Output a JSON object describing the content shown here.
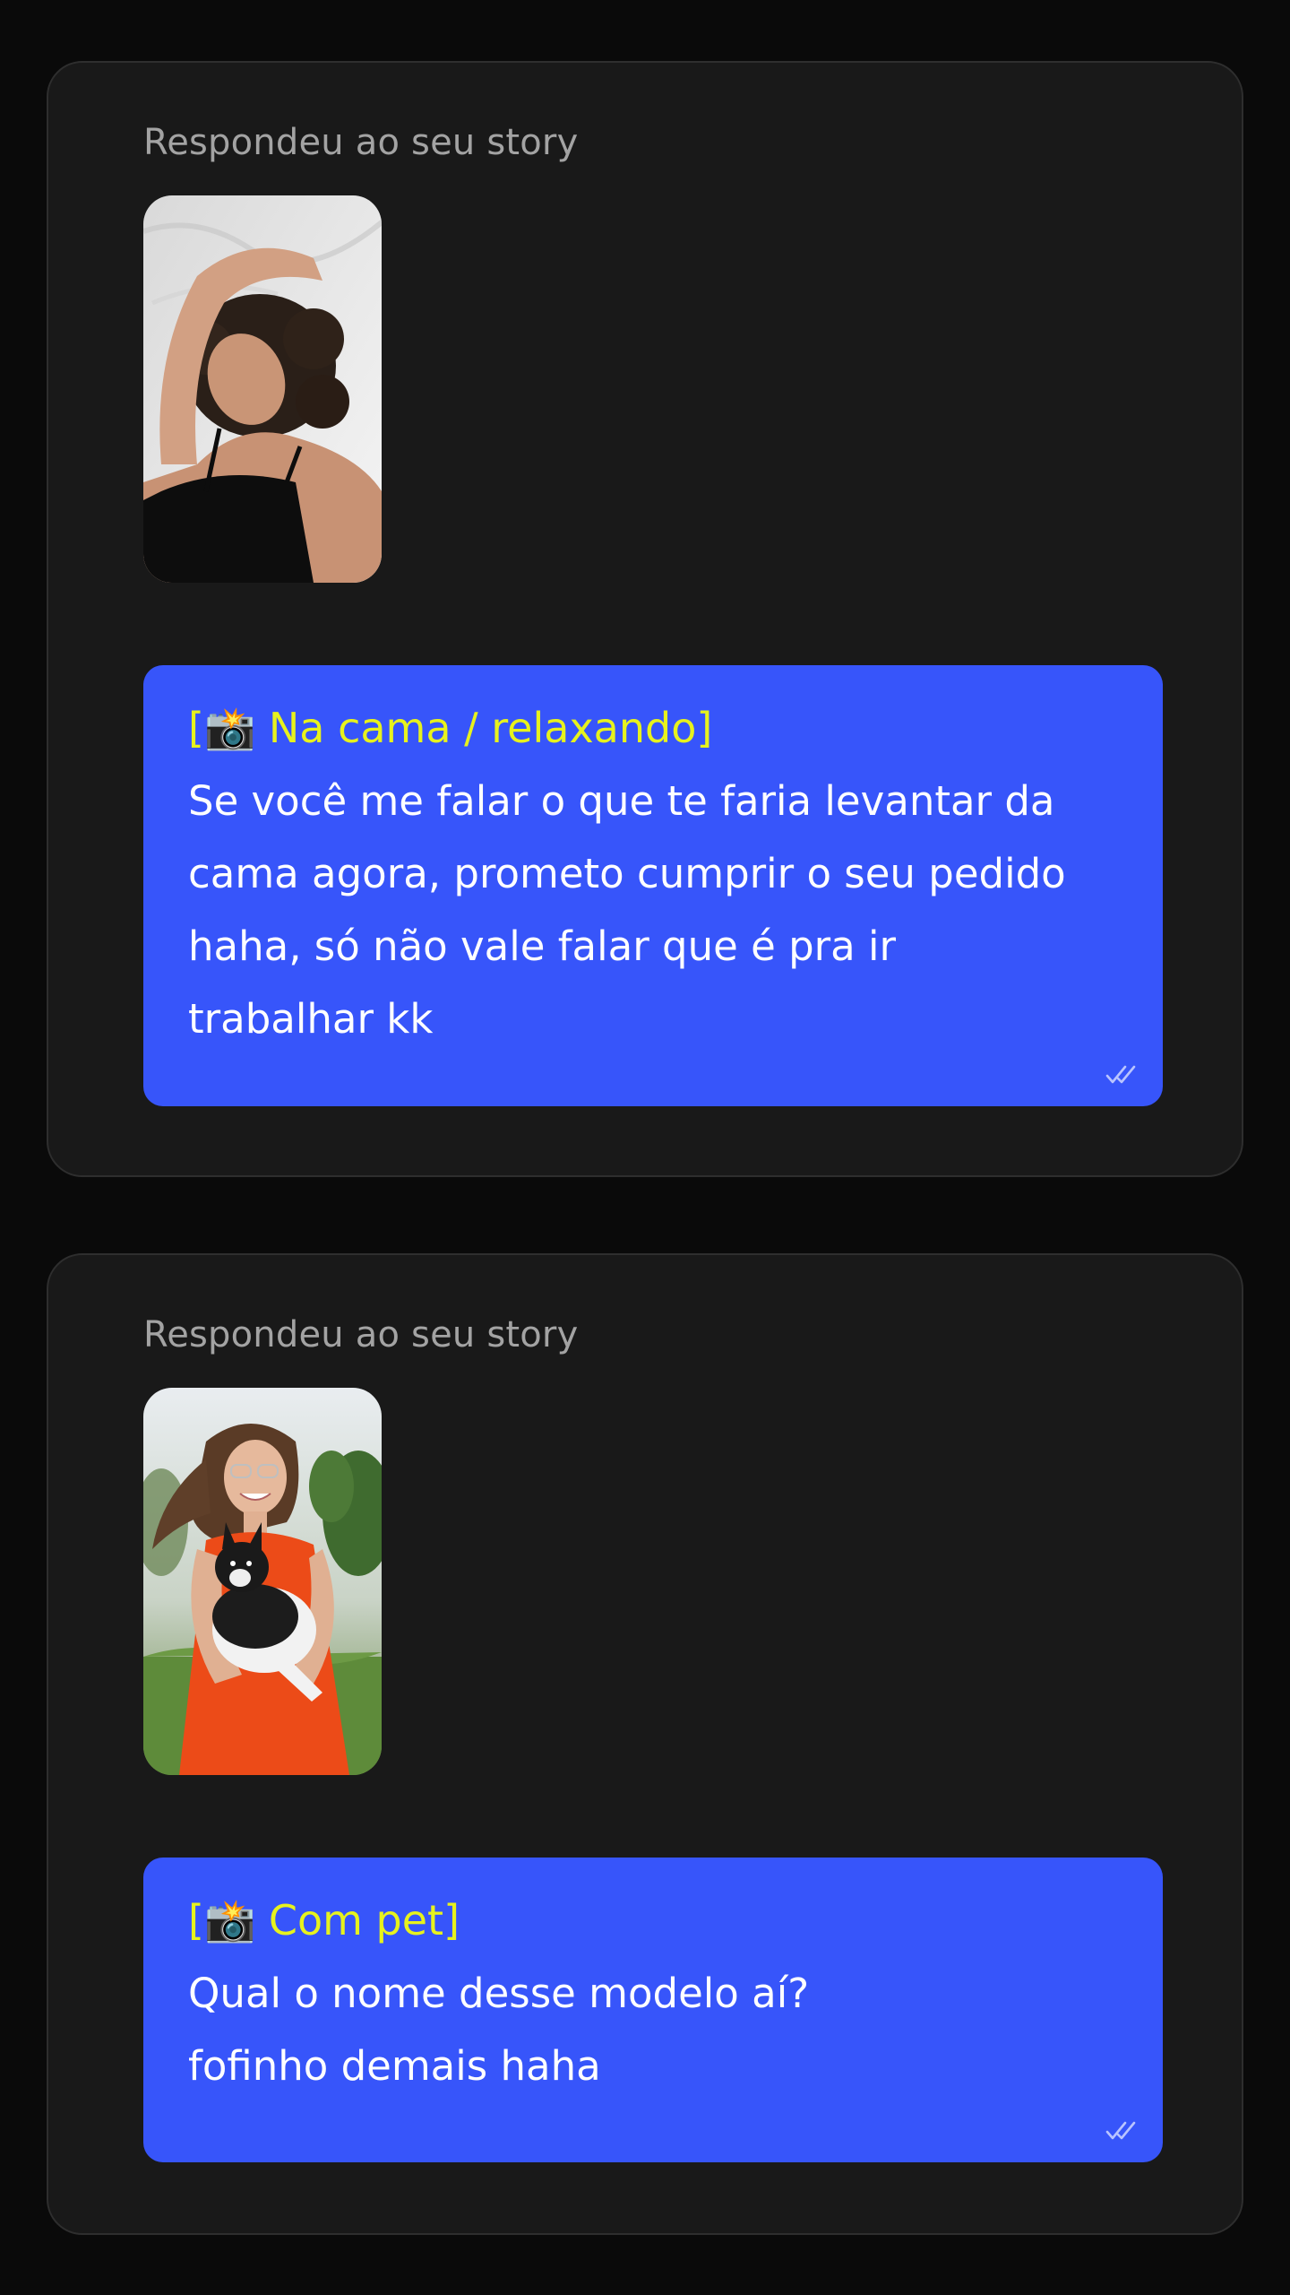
{
  "colors": {
    "page_background": "#0a0a0a",
    "card_background": "#191919",
    "bubble": "#3755fa",
    "caption": "#e7f21d",
    "label": "#a3a3a3"
  },
  "replies": [
    {
      "label": "Respondeu ao seu story",
      "thumbnail_icon": "story-photo-woman-relaxing-in-bed",
      "caption": "[📸 Na cama / relaxando]",
      "lines": [
        "Se você me falar o que te faria levantar da",
        "cama agora, prometo cumprir o seu pedido",
        "haha, só não vale falar que é pra ir",
        "trabalhar kk"
      ],
      "status_icon": "double-check-icon"
    },
    {
      "label": "Respondeu ao seu story",
      "thumbnail_icon": "story-photo-woman-holding-dog",
      "caption": "[📸 Com pet]",
      "lines": [
        "Qual o nome desse modelo aí?",
        "fofinho demais haha"
      ],
      "status_icon": "double-check-icon"
    }
  ]
}
